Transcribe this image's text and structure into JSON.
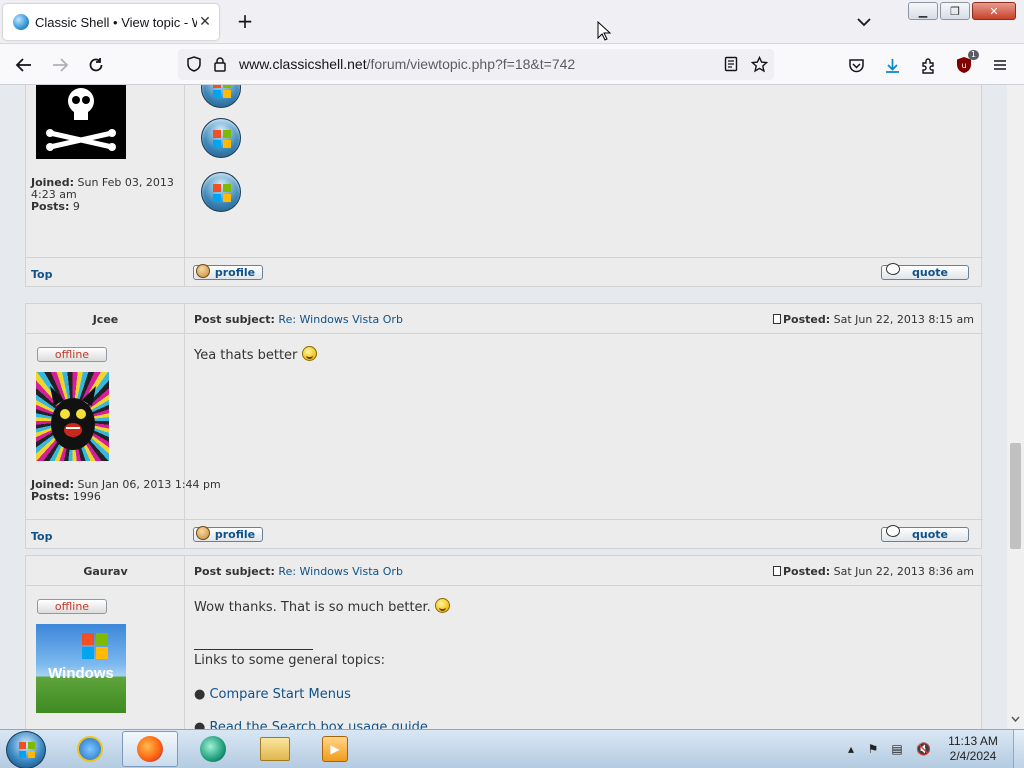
{
  "browser": {
    "tab_title": "Classic Shell • View topic - Windows Vista Orb",
    "new_tab_label": "+",
    "url_host": "www.classicshell.net",
    "url_path": "/forum/viewtopic.php?f=18&t=742",
    "extension_badge": "1"
  },
  "posts": [
    {
      "joined_label": "Joined:",
      "joined_value": "Sun Feb 03, 2013 4:23 am",
      "posts_label": "Posts:",
      "posts_value": "9",
      "top_label": "Top",
      "profile_label": "profile",
      "quote_label": "quote"
    },
    {
      "author": "Jcee",
      "subject_label": "Post subject:",
      "subject": "Re: Windows Vista Orb",
      "posted_label": "Posted:",
      "posted": "Sat Jun 22, 2013 8:15 am",
      "status": "offline",
      "message": "Yea thats better",
      "joined_label": "Joined:",
      "joined_value": "Sun Jan 06, 2013 1:44 pm",
      "posts_label": "Posts:",
      "posts_value": "1996",
      "top_label": "Top",
      "profile_label": "profile",
      "quote_label": "quote"
    },
    {
      "author": "Gaurav",
      "subject_label": "Post subject:",
      "subject": "Re: Windows Vista Orb",
      "posted_label": "Posted:",
      "posted": "Sat Jun 22, 2013 8:36 am",
      "status": "offline",
      "message": "Wow thanks. That is so much better.",
      "signature_heading": "Links to some general topics:",
      "signature_links": [
        "Compare Start Menus",
        "Read the Search box usage guide"
      ]
    }
  ],
  "taskbar": {
    "time": "11:13 AM",
    "date": "2/4/2024"
  }
}
